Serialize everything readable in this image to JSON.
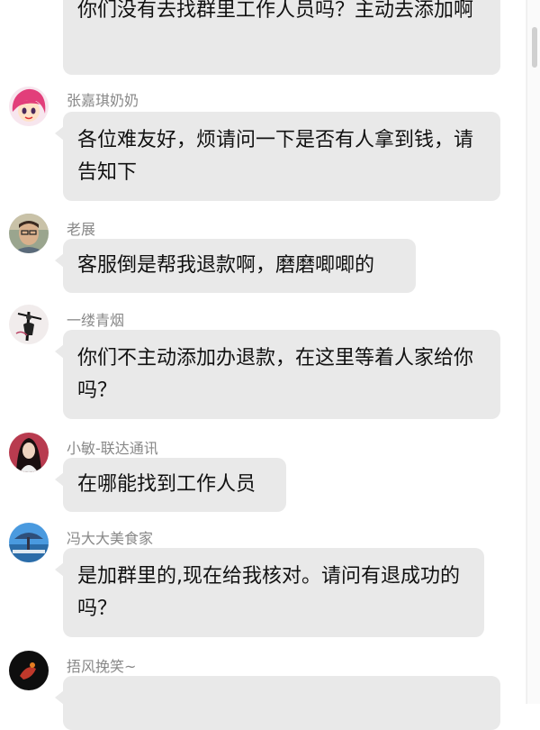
{
  "messages": [
    {
      "sender": "",
      "text": "你们没有去找群里工作人员吗？主动去添加啊"
    },
    {
      "sender": "张嘉琪奶奶",
      "text": "各位难友好，烦请问一下是否有人拿到钱，请告知下"
    },
    {
      "sender": "老展",
      "text": "客服倒是帮我退款啊，磨磨唧唧的"
    },
    {
      "sender": "一缕青烟",
      "text": "你们不主动添加办退款，在这里等着人家给你吗？"
    },
    {
      "sender": "小敏-联达通讯",
      "text": "在哪能找到工作人员"
    },
    {
      "sender": "冯大大美食家",
      "text": "是加群里的,现在给我核对。请问有退成功的吗？"
    },
    {
      "sender": "捂风挽笑~",
      "text": ""
    }
  ],
  "icons": {
    "avatars": [
      "avatar-cartoon-girl",
      "avatar-man-glasses",
      "avatar-black-white-figure",
      "avatar-woman-dark-hair",
      "avatar-blue-landscape",
      "avatar-dark-red"
    ]
  }
}
